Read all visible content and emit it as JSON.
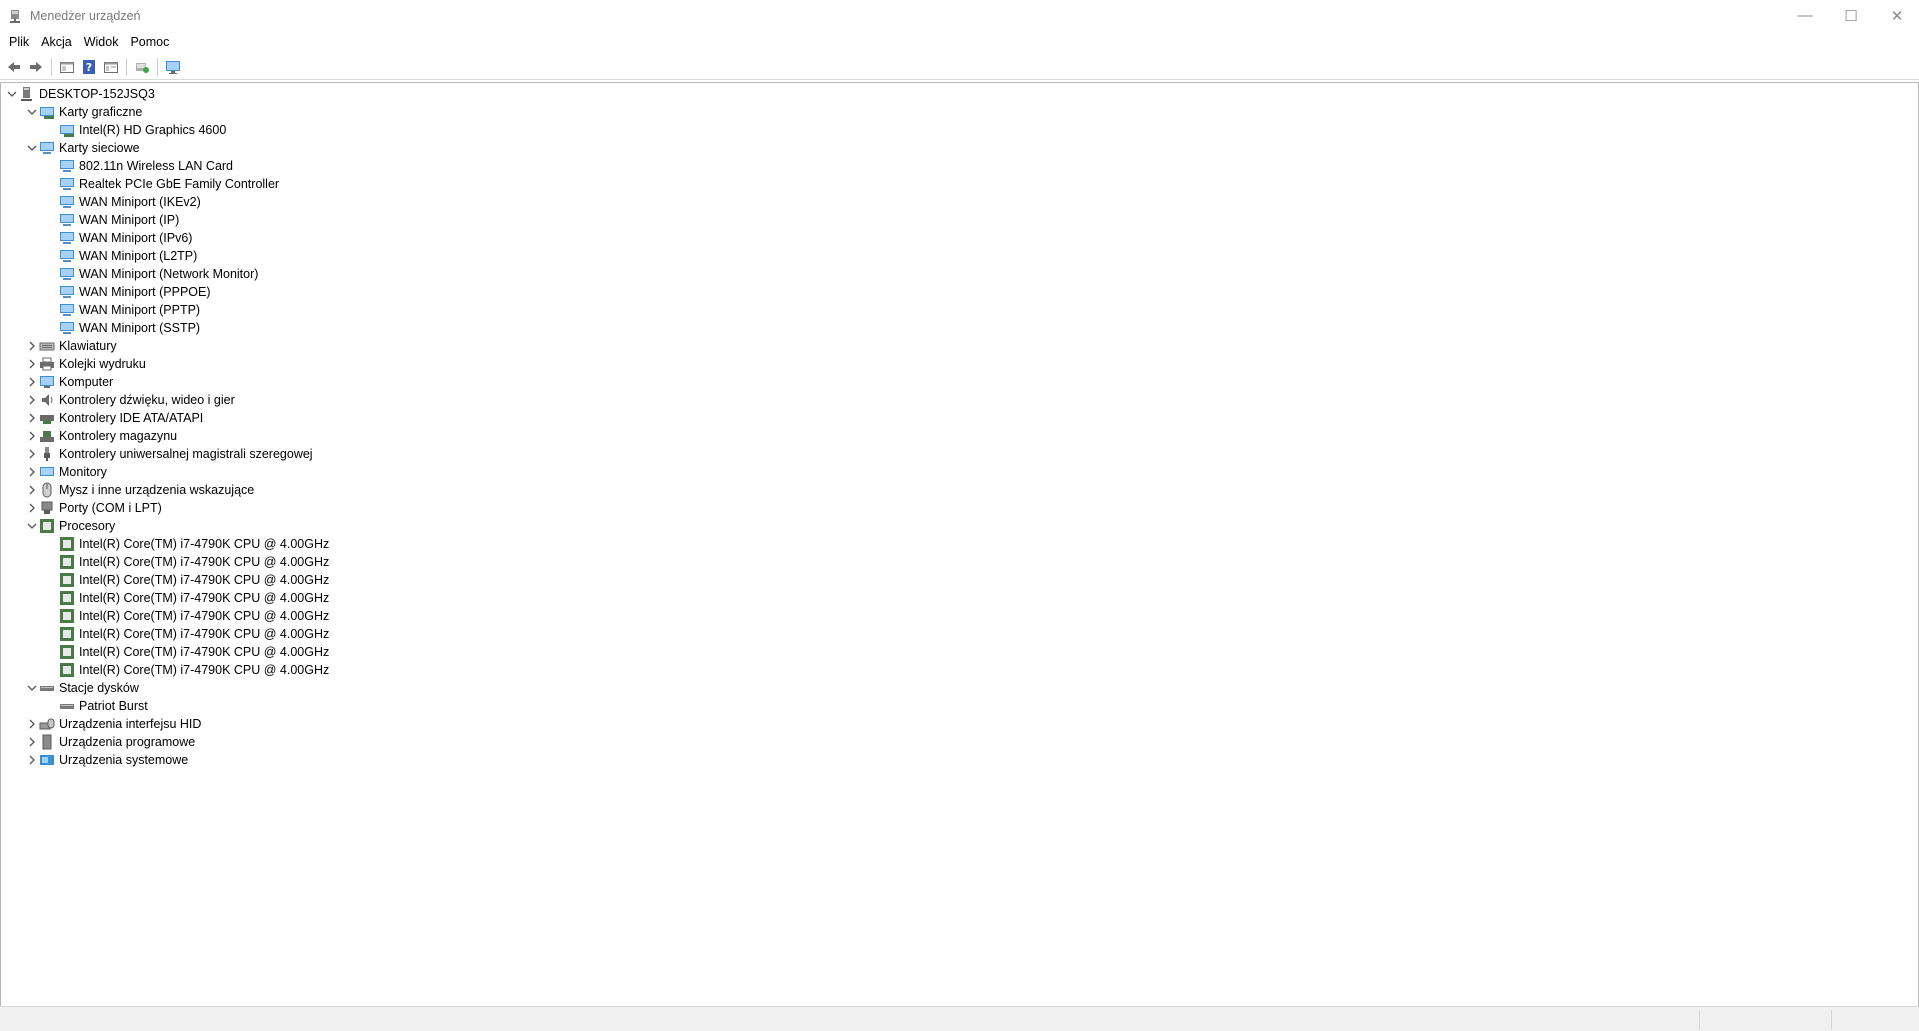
{
  "window": {
    "title": "Menedżer urządzeń",
    "minimize": "—",
    "maximize": "☐",
    "close": "✕"
  },
  "menu": [
    {
      "label": "Plik"
    },
    {
      "label": "Akcja"
    },
    {
      "label": "Widok"
    },
    {
      "label": "Pomoc"
    }
  ],
  "toolbar": {
    "buttons": [
      "back-arrow-icon",
      "forward-arrow-icon",
      "properties-icon",
      "help-icon",
      "view-icon",
      "update-driver-icon",
      "monitor-scan-icon"
    ]
  },
  "tree": {
    "root": "DESKTOP-152JSQ3",
    "groups": [
      {
        "label": "Karty graficzne",
        "icon": "display-adapter-icon",
        "expanded": true,
        "children": [
          "Intel(R) HD Graphics 4600"
        ]
      },
      {
        "label": "Karty sieciowe",
        "icon": "network-adapter-icon",
        "expanded": true,
        "children": [
          "802.11n Wireless LAN Card",
          "Realtek PCIe GbE Family Controller",
          "WAN Miniport (IKEv2)",
          "WAN Miniport (IP)",
          "WAN Miniport (IPv6)",
          "WAN Miniport (L2TP)",
          "WAN Miniport (Network Monitor)",
          "WAN Miniport (PPPOE)",
          "WAN Miniport (PPTP)",
          "WAN Miniport (SSTP)"
        ]
      },
      {
        "label": "Klawiatury",
        "icon": "keyboard-icon",
        "expanded": false,
        "children": []
      },
      {
        "label": "Kolejki wydruku",
        "icon": "printer-icon",
        "expanded": false,
        "children": []
      },
      {
        "label": "Komputer",
        "icon": "computer-icon",
        "expanded": false,
        "children": []
      },
      {
        "label": "Kontrolery dźwięku, wideo i gier",
        "icon": "speaker-icon",
        "expanded": false,
        "children": []
      },
      {
        "label": "Kontrolery IDE ATA/ATAPI",
        "icon": "ide-controller-icon",
        "expanded": false,
        "children": []
      },
      {
        "label": "Kontrolery magazynu",
        "icon": "storage-controller-icon",
        "expanded": false,
        "children": []
      },
      {
        "label": "Kontrolery uniwersalnej magistrali szeregowej",
        "icon": "usb-icon",
        "expanded": false,
        "children": []
      },
      {
        "label": "Monitory",
        "icon": "monitor-icon",
        "expanded": false,
        "children": []
      },
      {
        "label": "Mysz i inne urządzenia wskazujące",
        "icon": "mouse-icon",
        "expanded": false,
        "children": []
      },
      {
        "label": "Porty (COM i LPT)",
        "icon": "port-icon",
        "expanded": false,
        "children": []
      },
      {
        "label": "Procesory",
        "icon": "processor-icon",
        "expanded": true,
        "children": [
          "Intel(R) Core(TM) i7-4790K CPU @ 4.00GHz",
          "Intel(R) Core(TM) i7-4790K CPU @ 4.00GHz",
          "Intel(R) Core(TM) i7-4790K CPU @ 4.00GHz",
          "Intel(R) Core(TM) i7-4790K CPU @ 4.00GHz",
          "Intel(R) Core(TM) i7-4790K CPU @ 4.00GHz",
          "Intel(R) Core(TM) i7-4790K CPU @ 4.00GHz",
          "Intel(R) Core(TM) i7-4790K CPU @ 4.00GHz",
          "Intel(R) Core(TM) i7-4790K CPU @ 4.00GHz"
        ]
      },
      {
        "label": "Stacje dysków",
        "icon": "disk-drive-icon",
        "expanded": true,
        "children": [
          "Patriot Burst"
        ]
      },
      {
        "label": "Urządzenia interfejsu HID",
        "icon": "hid-icon",
        "expanded": false,
        "children": []
      },
      {
        "label": "Urządzenia programowe",
        "icon": "software-device-icon",
        "expanded": false,
        "children": []
      },
      {
        "label": "Urządzenia systemowe",
        "icon": "system-device-icon",
        "expanded": false,
        "children": []
      }
    ]
  },
  "colors": {
    "network_blue": "#3a8fd8",
    "processor_green": "#4a7a45",
    "title_gray": "#7a7a7a"
  }
}
